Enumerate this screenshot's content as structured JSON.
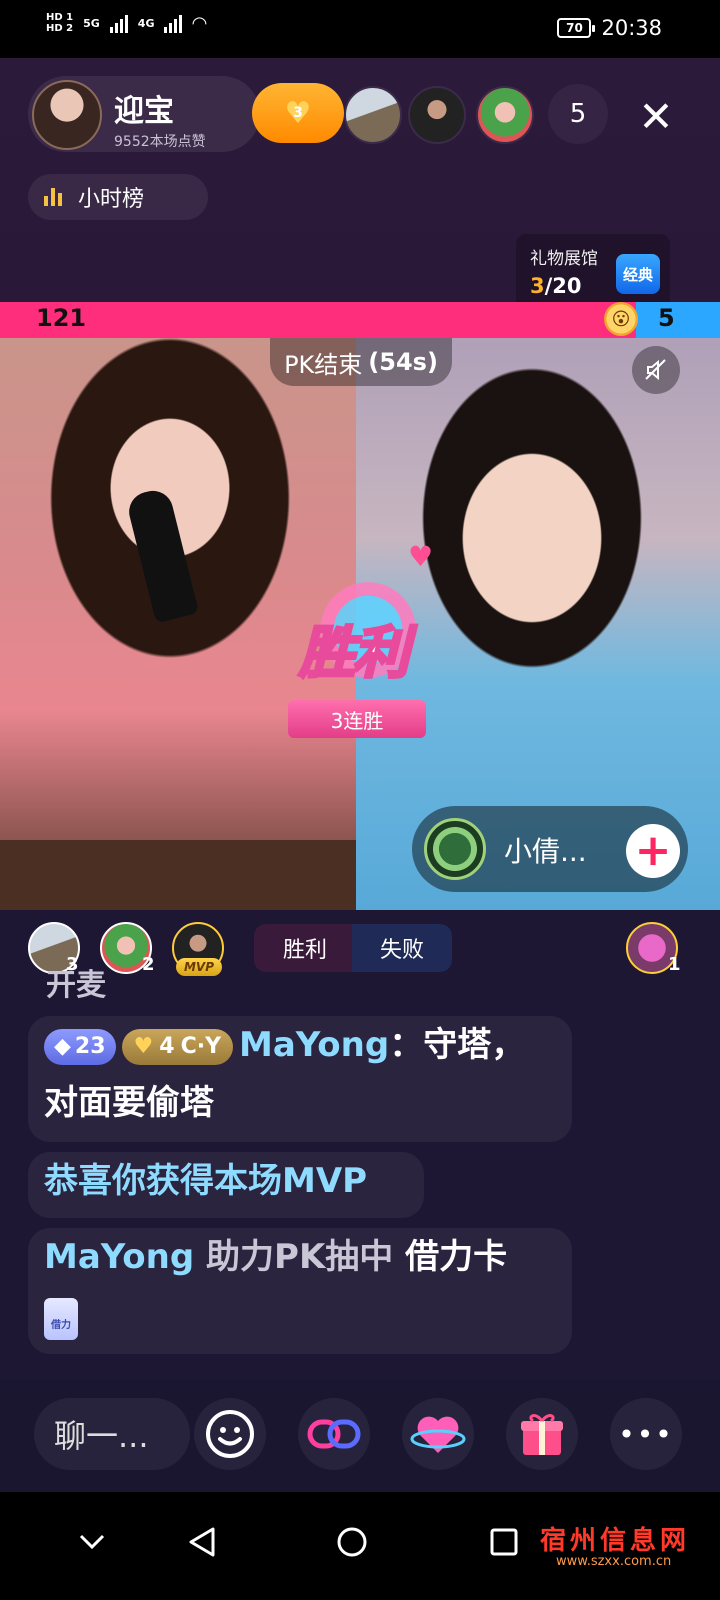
{
  "status_bar": {
    "network_labels": [
      "HD 1",
      "HD 2"
    ],
    "network_type_1": "5G",
    "network_type_2": "4G",
    "battery": "70",
    "time": "20:38"
  },
  "header": {
    "host_name": "迎宝",
    "host_likes": "9552本场点赞",
    "fan_club_level": "3",
    "viewer_count": "5",
    "hour_rank_label": "小时榜"
  },
  "gift_hall": {
    "title": "礼物展馆",
    "progress_current": "3",
    "progress_total": "/20",
    "badge": "经典"
  },
  "pk": {
    "left_score": "121",
    "right_score": "5",
    "status_label": "PK结束",
    "status_timer": "(54s)",
    "win_text": "胜利",
    "streak_text": "3连胜",
    "opponent_name": "小倩...",
    "result_win": "胜利",
    "result_lose": "失败",
    "contributors": [
      {
        "rank": "3"
      },
      {
        "rank": "2"
      },
      {
        "rank": "MVP"
      }
    ],
    "opponent_contributor_rank": "1"
  },
  "chat": {
    "partial_message": "开麦",
    "messages": [
      {
        "level": "23",
        "fan_level": "4",
        "fan_tag": "C·Y",
        "user": "MaYong",
        "separator": "：",
        "text": "守塔，对面要偷塔"
      },
      {
        "text": "恭喜你获得本场MVP"
      },
      {
        "user": "MaYong",
        "text": " 助力PK抽中 ",
        "item": "借力卡",
        "card_label": "借力"
      }
    ]
  },
  "bottom_bar": {
    "chat_placeholder": "聊一...",
    "more": "•••"
  },
  "watermark": {
    "title": "宿州信息网",
    "url": "www.szxx.com.cn"
  },
  "colors": {
    "pk_left": "#ff2e7d",
    "pk_right": "#2ba7ff",
    "accent_gold": "#ffb12b",
    "username": "#8edbff"
  }
}
